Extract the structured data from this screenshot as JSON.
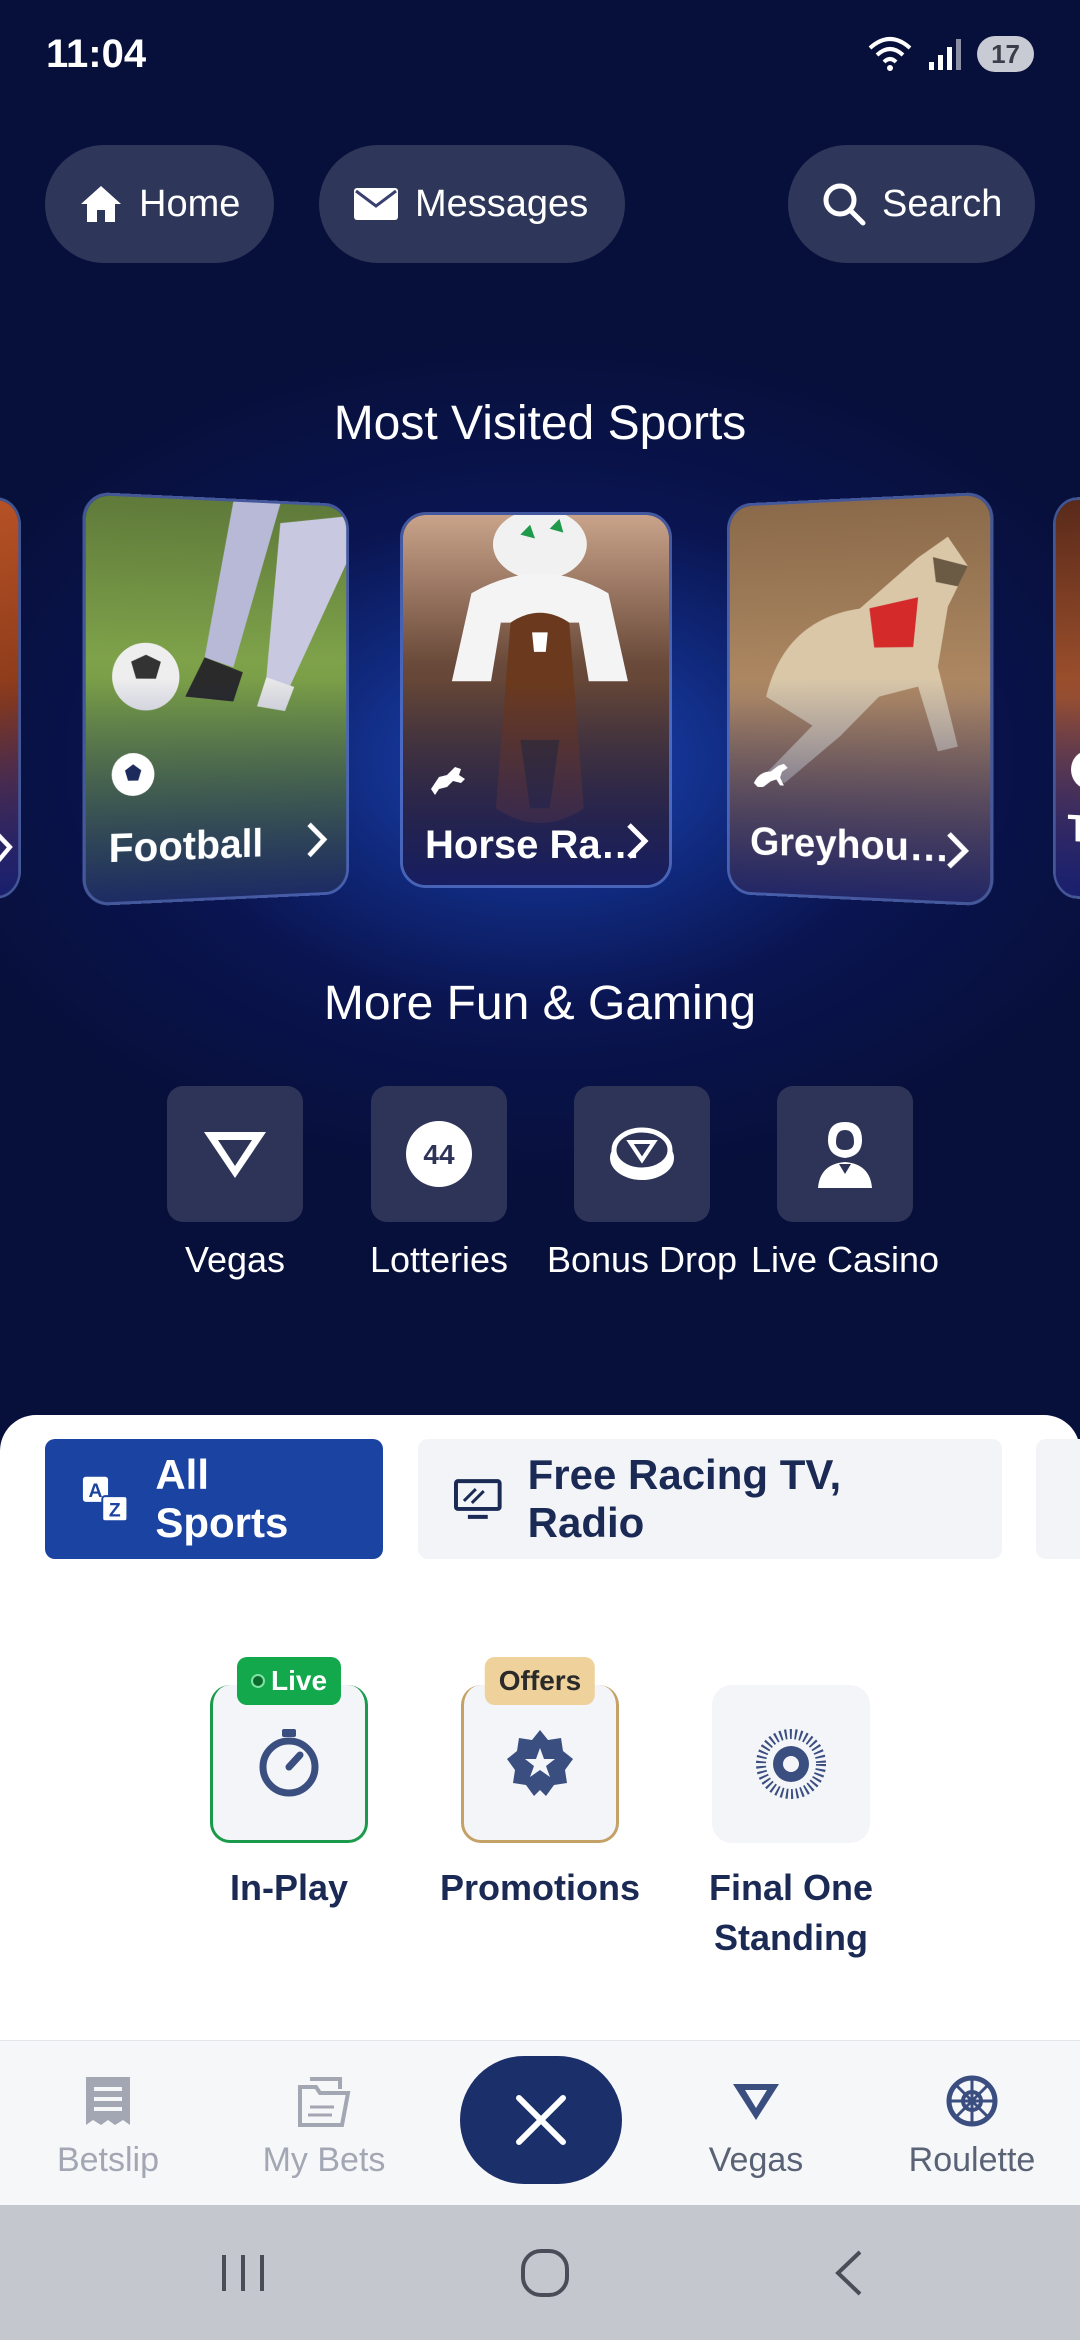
{
  "status_bar": {
    "time": "11:04",
    "battery": "17",
    "icons": [
      "wifi-icon",
      "signal-icon",
      "battery-icon"
    ]
  },
  "header": {
    "home_label": "Home",
    "messages_label": "Messages",
    "search_label": "Search"
  },
  "most_visited": {
    "title": "Most Visited Sports",
    "cards": [
      {
        "label": "Football",
        "icon": "football-icon"
      },
      {
        "label": "Horse Ra…",
        "icon": "horse-racing-icon"
      },
      {
        "label": "Greyhou…",
        "icon": "greyhound-icon"
      },
      {
        "label": "T",
        "icon": "tennis-icon"
      }
    ]
  },
  "more_fun": {
    "title": "More Fun & Gaming",
    "items": [
      {
        "label": "Vegas",
        "icon": "vegas-logo-icon"
      },
      {
        "label": "Lotteries",
        "icon": "lottery-ball-icon",
        "ball_number": "44"
      },
      {
        "label": "Bonus Drop",
        "icon": "bonus-drop-coin-icon"
      },
      {
        "label": "Live Casino",
        "icon": "dealer-icon"
      }
    ]
  },
  "filter_chips": {
    "all_sports": "All Sports",
    "free_racing": "Free Racing TV, Radio"
  },
  "quick_links": [
    {
      "label": "In-Play",
      "badge": "Live",
      "icon": "stopwatch-icon"
    },
    {
      "label": "Promotions",
      "badge": "Offers",
      "icon": "star-badge-icon"
    },
    {
      "label": "Final One Standing",
      "badge": "",
      "icon": "dotted-circle-icon"
    }
  ],
  "tab_bar": {
    "betslip": "Betslip",
    "my_bets": "My Bets",
    "vegas": "Vegas",
    "roulette": "Roulette"
  },
  "colors": {
    "header_bg": "#0a1450",
    "accent_blue": "#1a43a2",
    "live_green": "#13a84c",
    "offers_gold": "#efd19b",
    "text_navy": "#1b2a55"
  }
}
